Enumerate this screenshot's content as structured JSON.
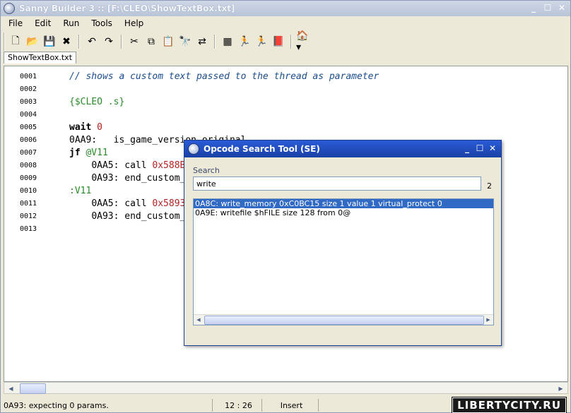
{
  "window": {
    "title": "Sanny Builder 3 :: [F:\\CLEO\\ShowTextBox.txt]"
  },
  "menu": [
    "File",
    "Edit",
    "Run",
    "Tools",
    "Help"
  ],
  "toolbar": [
    {
      "name": "new-file-icon",
      "glyph": "🗋"
    },
    {
      "name": "open-folder-icon",
      "glyph": "📂"
    },
    {
      "name": "save-icon",
      "glyph": "💾"
    },
    {
      "name": "close-icon",
      "glyph": "✖"
    },
    {
      "name": "sep"
    },
    {
      "name": "undo-icon",
      "glyph": "↶"
    },
    {
      "name": "redo-icon",
      "glyph": "↷"
    },
    {
      "name": "sep"
    },
    {
      "name": "cut-icon",
      "glyph": "✂"
    },
    {
      "name": "copy-icon",
      "glyph": "⧉"
    },
    {
      "name": "paste-icon",
      "glyph": "📋"
    },
    {
      "name": "find-icon",
      "glyph": "🔭"
    },
    {
      "name": "replace-icon",
      "glyph": "⇄"
    },
    {
      "name": "sep"
    },
    {
      "name": "compile-icon",
      "glyph": "▦"
    },
    {
      "name": "run-icon",
      "glyph": "🏃"
    },
    {
      "name": "run-alt-icon",
      "glyph": "🏃"
    },
    {
      "name": "decompile-icon",
      "glyph": "📕"
    },
    {
      "name": "sep"
    },
    {
      "name": "options-dropdown-icon",
      "glyph": "🏠▾"
    }
  ],
  "tab": {
    "label": "ShowTextBox.txt"
  },
  "code_lines": [
    {
      "num": "0001",
      "indent": "",
      "tokens": [
        {
          "t": "// shows a custom text passed to the thread as parameter",
          "c": "c-comment"
        }
      ]
    },
    {
      "num": "0002",
      "indent": "",
      "tokens": []
    },
    {
      "num": "0003",
      "indent": "",
      "tokens": [
        {
          "t": "{$CLEO .s}",
          "c": "c-green"
        }
      ]
    },
    {
      "num": "0004",
      "indent": "",
      "tokens": []
    },
    {
      "num": "0005",
      "indent": "",
      "tokens": [
        {
          "t": "wait ",
          "c": "c-bold"
        },
        {
          "t": "0",
          "c": "c-red"
        }
      ]
    },
    {
      "num": "0006",
      "indent": "",
      "tokens": [
        {
          "t": "0AA9:   is_game_version_original",
          "c": ""
        }
      ]
    },
    {
      "num": "0007",
      "indent": "",
      "tokens": [
        {
          "t": "jf ",
          "c": "c-bold"
        },
        {
          "t": "@V11",
          "c": "c-green"
        }
      ]
    },
    {
      "num": "0008",
      "indent": "    ",
      "tokens": [
        {
          "t": "0AA5: call ",
          "c": ""
        },
        {
          "t": "0x588B",
          "c": "c-red"
        }
      ]
    },
    {
      "num": "0009",
      "indent": "    ",
      "tokens": [
        {
          "t": "0A93: end_custom_",
          "c": ""
        }
      ]
    },
    {
      "num": "0010",
      "indent": "",
      "tokens": [
        {
          "t": ":V11",
          "c": "c-green"
        }
      ]
    },
    {
      "num": "0011",
      "indent": "    ",
      "tokens": [
        {
          "t": "0AA5: call ",
          "c": ""
        },
        {
          "t": "0x5893",
          "c": "c-red"
        }
      ]
    },
    {
      "num": "0012",
      "indent": "    ",
      "tokens": [
        {
          "t": "0A93: end_custom_",
          "c": ""
        }
      ]
    },
    {
      "num": "0013",
      "indent": "",
      "tokens": []
    }
  ],
  "status": {
    "message": "0A93: expecting 0 params.",
    "position": "12 :  26",
    "mode": "Insert"
  },
  "watermark": "LIBERTYCITY.RU",
  "dialog": {
    "title": "Opcode Search Tool  (SE)",
    "search_label": "Search",
    "search_value": "write",
    "count": "2",
    "results": [
      "0A8C: write_memory 0xC0BC15 size 1 value 1 virtual_protect 0",
      "0A9E: writefile $hFILE size 128 from 0@"
    ],
    "selected_index": 0
  }
}
